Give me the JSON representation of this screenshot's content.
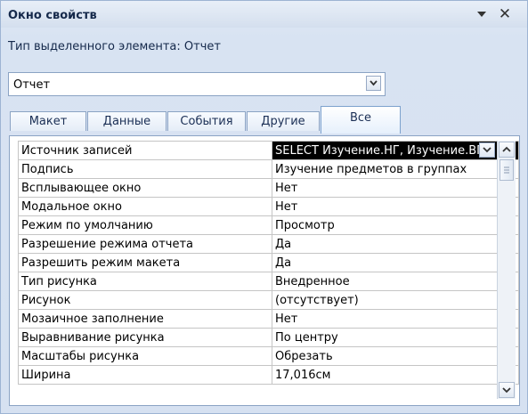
{
  "window": {
    "title": "Окно свойств",
    "close_glyph": "✕",
    "dropdown_icon": "triangle-down-icon"
  },
  "selection": {
    "type_label": "Тип выделенного элемента:",
    "type_value": "Отчет",
    "combo_value": "Отчет"
  },
  "tabs": [
    {
      "label": "Макет",
      "active": false
    },
    {
      "label": "Данные",
      "active": false
    },
    {
      "label": "События",
      "active": false
    },
    {
      "label": "Другие",
      "active": false
    },
    {
      "label": "Все",
      "active": true
    }
  ],
  "properties": [
    {
      "name": "Источник записей",
      "value": "SELECT Изучение.НГ, Изучение.ВГ",
      "selected": true
    },
    {
      "name": "Подпись",
      "value": "Изучение предметов в группах"
    },
    {
      "name": "Всплывающее окно",
      "value": "Нет"
    },
    {
      "name": "Модальное окно",
      "value": "Нет"
    },
    {
      "name": "Режим по умолчанию",
      "value": "Просмотр"
    },
    {
      "name": "Разрешение режима отчета",
      "value": "Да"
    },
    {
      "name": "Разрешить режим макета",
      "value": "Да"
    },
    {
      "name": "Тип рисунка",
      "value": "Внедренное"
    },
    {
      "name": "Рисунок",
      "value": "(отсутствует)"
    },
    {
      "name": "Мозаичное заполнение",
      "value": "Нет"
    },
    {
      "name": "Выравнивание рисунка",
      "value": "По центру"
    },
    {
      "name": "Масштабы рисунка",
      "value": "Обрезать"
    },
    {
      "name": "Ширина",
      "value": "17,016см"
    }
  ],
  "colors": {
    "panel_bg": "#d8e3f2",
    "border": "#8ba3c4",
    "selected_bg": "#000000",
    "title_text": "#15294b"
  }
}
